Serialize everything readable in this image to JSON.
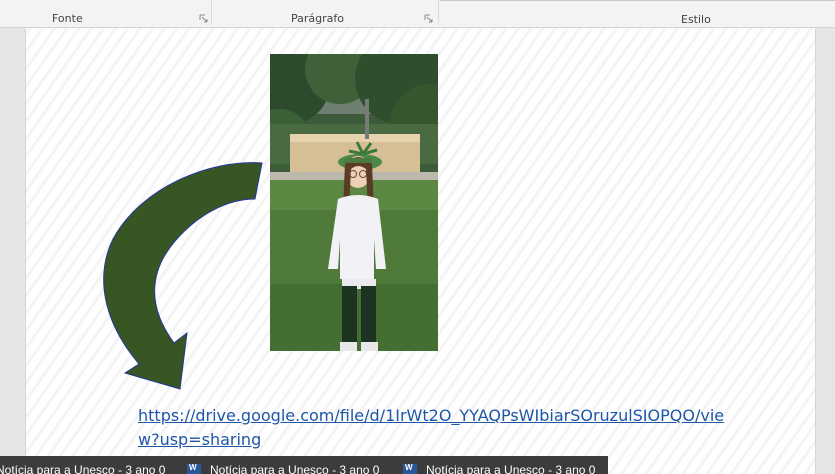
{
  "ribbon": {
    "groups": [
      {
        "label": "Fonte"
      },
      {
        "label": "Parágrafo"
      },
      {
        "label": "Estilo"
      }
    ]
  },
  "document": {
    "link_text": "https://drive.google.com/file/d/1IrWt2O_YYAQPsWIbiarSOruzulSIOPQO/view?usp=sharing",
    "arrow_color": "#375623",
    "link_color": "#1e56a8"
  },
  "taskbar": {
    "items": [
      {
        "label": "Notícia para a Unesco - 3 ano 0",
        "icon": "word-icon"
      },
      {
        "label": "Notícia para a Unesco - 3 ano 0",
        "icon": "word-icon"
      },
      {
        "label": "Notícia para a Unesco - 3 ano 0",
        "icon": "word-icon"
      }
    ]
  }
}
